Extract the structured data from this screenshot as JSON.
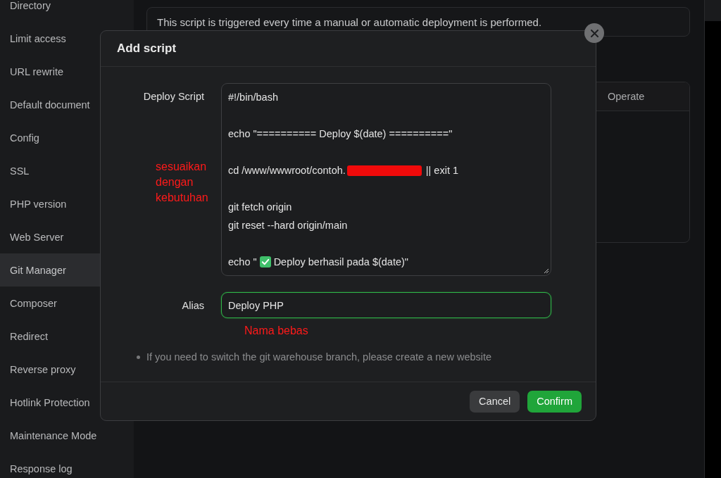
{
  "sidebar": {
    "items": [
      {
        "label": "Directory",
        "selected": false
      },
      {
        "label": "Limit access",
        "selected": false
      },
      {
        "label": "URL rewrite",
        "selected": false
      },
      {
        "label": "Default document",
        "selected": false
      },
      {
        "label": "Config",
        "selected": false
      },
      {
        "label": "SSL",
        "selected": false
      },
      {
        "label": "PHP version",
        "selected": false
      },
      {
        "label": "Web Server",
        "selected": false
      },
      {
        "label": "Git Manager",
        "selected": true
      },
      {
        "label": "Composer",
        "selected": false
      },
      {
        "label": "Redirect",
        "selected": false
      },
      {
        "label": "Reverse proxy",
        "selected": false
      },
      {
        "label": "Hotlink Protection",
        "selected": false
      },
      {
        "label": "Maintenance Mode",
        "selected": false
      },
      {
        "label": "Response log",
        "selected": false
      }
    ]
  },
  "info_banner": {
    "text": "This script is triggered every time a manual or automatic deployment is performed."
  },
  "table": {
    "columns": [
      {
        "label": "Operate"
      }
    ]
  },
  "dialog": {
    "title": "Add script",
    "fields": [
      {
        "kind": "script",
        "label": "Deploy Script",
        "annotation": "sesuaikan dengan kebutuhan",
        "lines": [
          {
            "kind": "code",
            "segments": [
              {
                "kind": "text",
                "text": "#!/bin/bash"
              }
            ]
          },
          {
            "kind": "blank"
          },
          {
            "kind": "code",
            "segments": [
              {
                "kind": "text",
                "text": "echo \"========== Deploy $(date) ==========\""
              }
            ]
          },
          {
            "kind": "blank"
          },
          {
            "kind": "code",
            "segments": [
              {
                "kind": "text",
                "text": "cd /www/wwwroot/contoh."
              },
              {
                "kind": "redaction"
              },
              {
                "kind": "text",
                "text": "|| exit 1"
              }
            ]
          },
          {
            "kind": "blank"
          },
          {
            "kind": "code",
            "segments": [
              {
                "kind": "text",
                "text": "git fetch origin"
              }
            ]
          },
          {
            "kind": "code",
            "segments": [
              {
                "kind": "text",
                "text": "git reset --hard origin/main"
              }
            ]
          },
          {
            "kind": "blank"
          },
          {
            "kind": "code",
            "segments": [
              {
                "kind": "text",
                "text": "echo \""
              },
              {
                "kind": "check"
              },
              {
                "kind": "text",
                "text": "Deploy berhasil pada $(date)\""
              }
            ]
          }
        ]
      },
      {
        "kind": "text",
        "label": "Alias",
        "value": "Deploy PHP",
        "focused": true,
        "annotation": "Nama bebas"
      }
    ],
    "note": "If you need to switch the git warehouse branch, please create a new website",
    "buttons": [
      {
        "label": "Cancel",
        "kind": "secondary"
      },
      {
        "label": "Confirm",
        "kind": "primary"
      }
    ]
  }
}
